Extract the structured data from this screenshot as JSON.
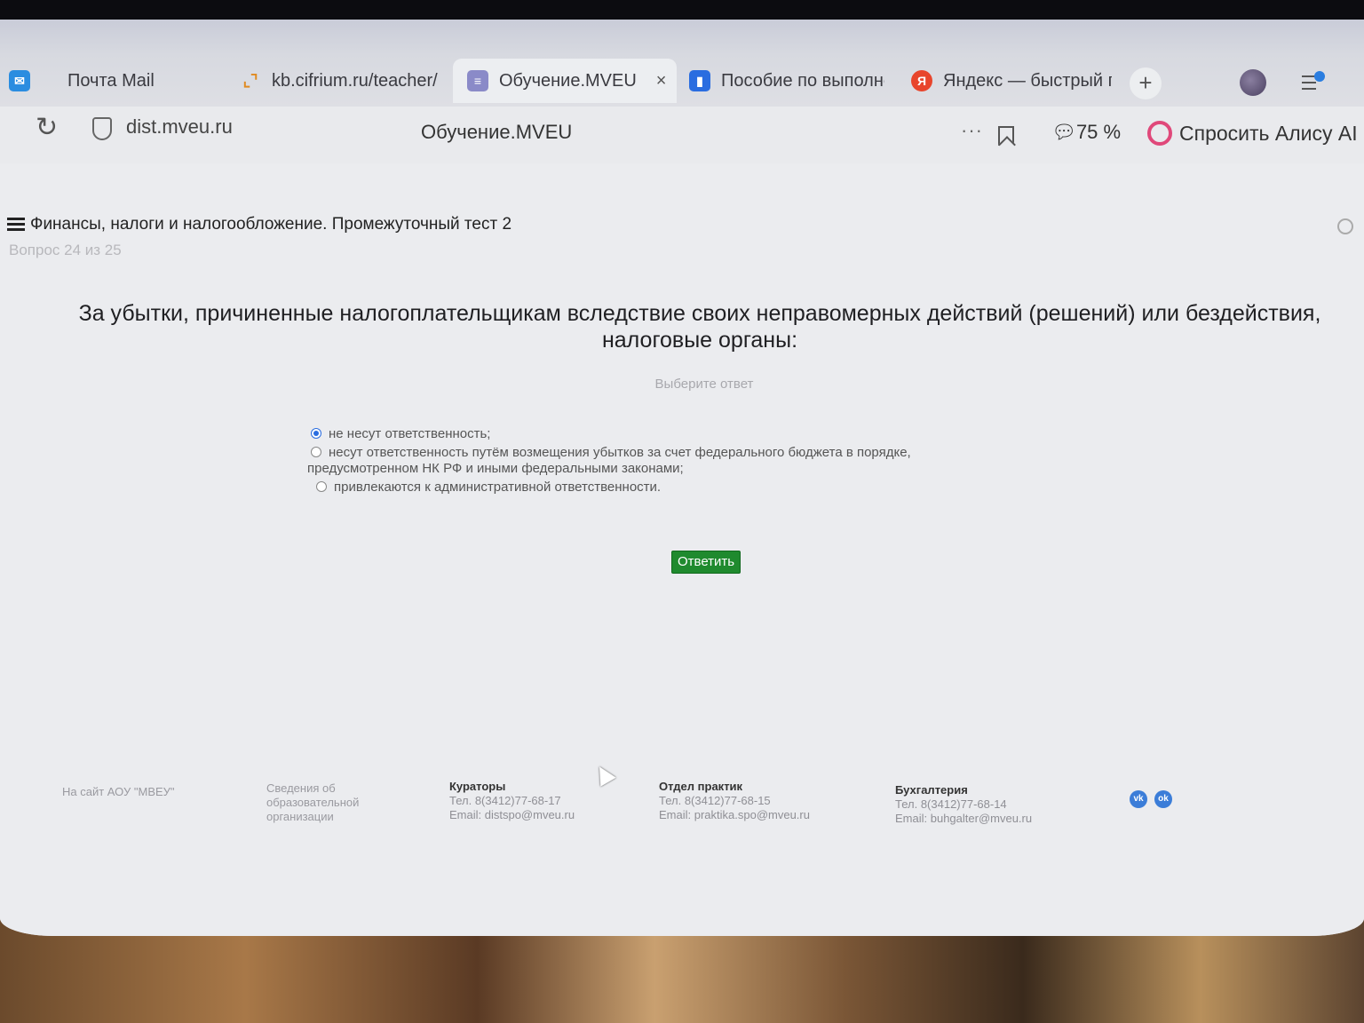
{
  "browser": {
    "tabs": [
      {
        "label": "Почта Mail",
        "icon": "mail-icon",
        "color": "#2a8de0"
      },
      {
        "label": "kb.cifrium.ru/teacher/",
        "icon": "cifrium-icon",
        "color": "#e08a20"
      },
      {
        "label": "Обучение.MVEU",
        "icon": "mveu-icon",
        "color": "#8080c0",
        "active": true
      },
      {
        "label": "Пособие по выполнени",
        "icon": "doc-icon",
        "color": "#2a6de0"
      },
      {
        "label": "Яндекс — быстрый п",
        "icon": "yandex-icon",
        "color": "#e8452c"
      }
    ],
    "url": "dist.mveu.ru",
    "page_title": "Обучение.MVEU",
    "zoom": "75 %",
    "alice_label": "Спросить Алису AI"
  },
  "page": {
    "test_title": "Финансы, налоги и налогообложение. Промежуточный тест 2",
    "question_counter": "Вопрос 24 из 25",
    "question": "За убытки, причиненные налогоплательщикам вследствие своих неправомерных действий (решений) или бездействия, налоговые органы:",
    "hint": "Выберите ответ",
    "answers": [
      {
        "text": "не несут ответственность;",
        "selected": true
      },
      {
        "text": "несут ответственность путём возмещения убытков за счет федерального бюджета в порядке, предусмотренном НК РФ и иными федеральными законами;",
        "selected": false
      },
      {
        "text": "привлекаются к административной ответственности.",
        "selected": false
      }
    ],
    "submit_label": "Ответить"
  },
  "footer": {
    "site_link": "На сайт АОУ \"МВЕУ\"",
    "info_link": "Сведения об образовательной организации",
    "curators": {
      "title": "Кураторы",
      "phone": "Тел. 8(3412)77-68-17",
      "email": "Email: distspo@mveu.ru"
    },
    "practice": {
      "title": "Отдел практик",
      "phone": "Тел. 8(3412)77-68-15",
      "email": "Email: praktika.spo@mveu.ru"
    },
    "accounting": {
      "title": "Бухгалтерия",
      "phone": "Тел. 8(3412)77-68-14",
      "email": "Email: buhgalter@mveu.ru"
    },
    "social": [
      "vk-icon",
      "ok-icon"
    ]
  }
}
